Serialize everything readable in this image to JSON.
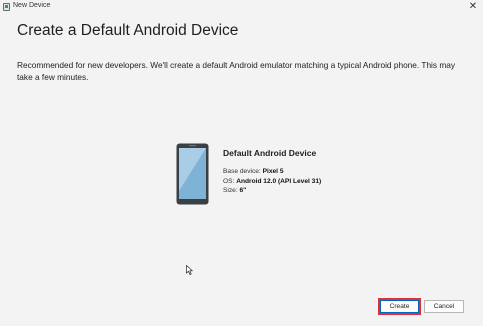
{
  "window": {
    "title": "New Device",
    "close_glyph": "✕"
  },
  "page": {
    "heading": "Create a Default Android Device",
    "description": "Recommended for new developers. We'll create a default Android emulator matching a typical Android phone. This may take a few minutes."
  },
  "device": {
    "icon": "phone-icon",
    "name": "Default Android Device",
    "base_label": "Base device: ",
    "base_value": "Pixel 5",
    "os_label": "OS: ",
    "os_value": "Android 12.0 (API Level 31)",
    "size_label": "Size: ",
    "size_value": "6\""
  },
  "buttons": {
    "create": "Create",
    "cancel": "Cancel"
  },
  "colors": {
    "background": "#f3f3f3",
    "highlight": "#e0303a",
    "phone_screen": "#7fb3d5",
    "phone_body": "#3a3f44"
  }
}
